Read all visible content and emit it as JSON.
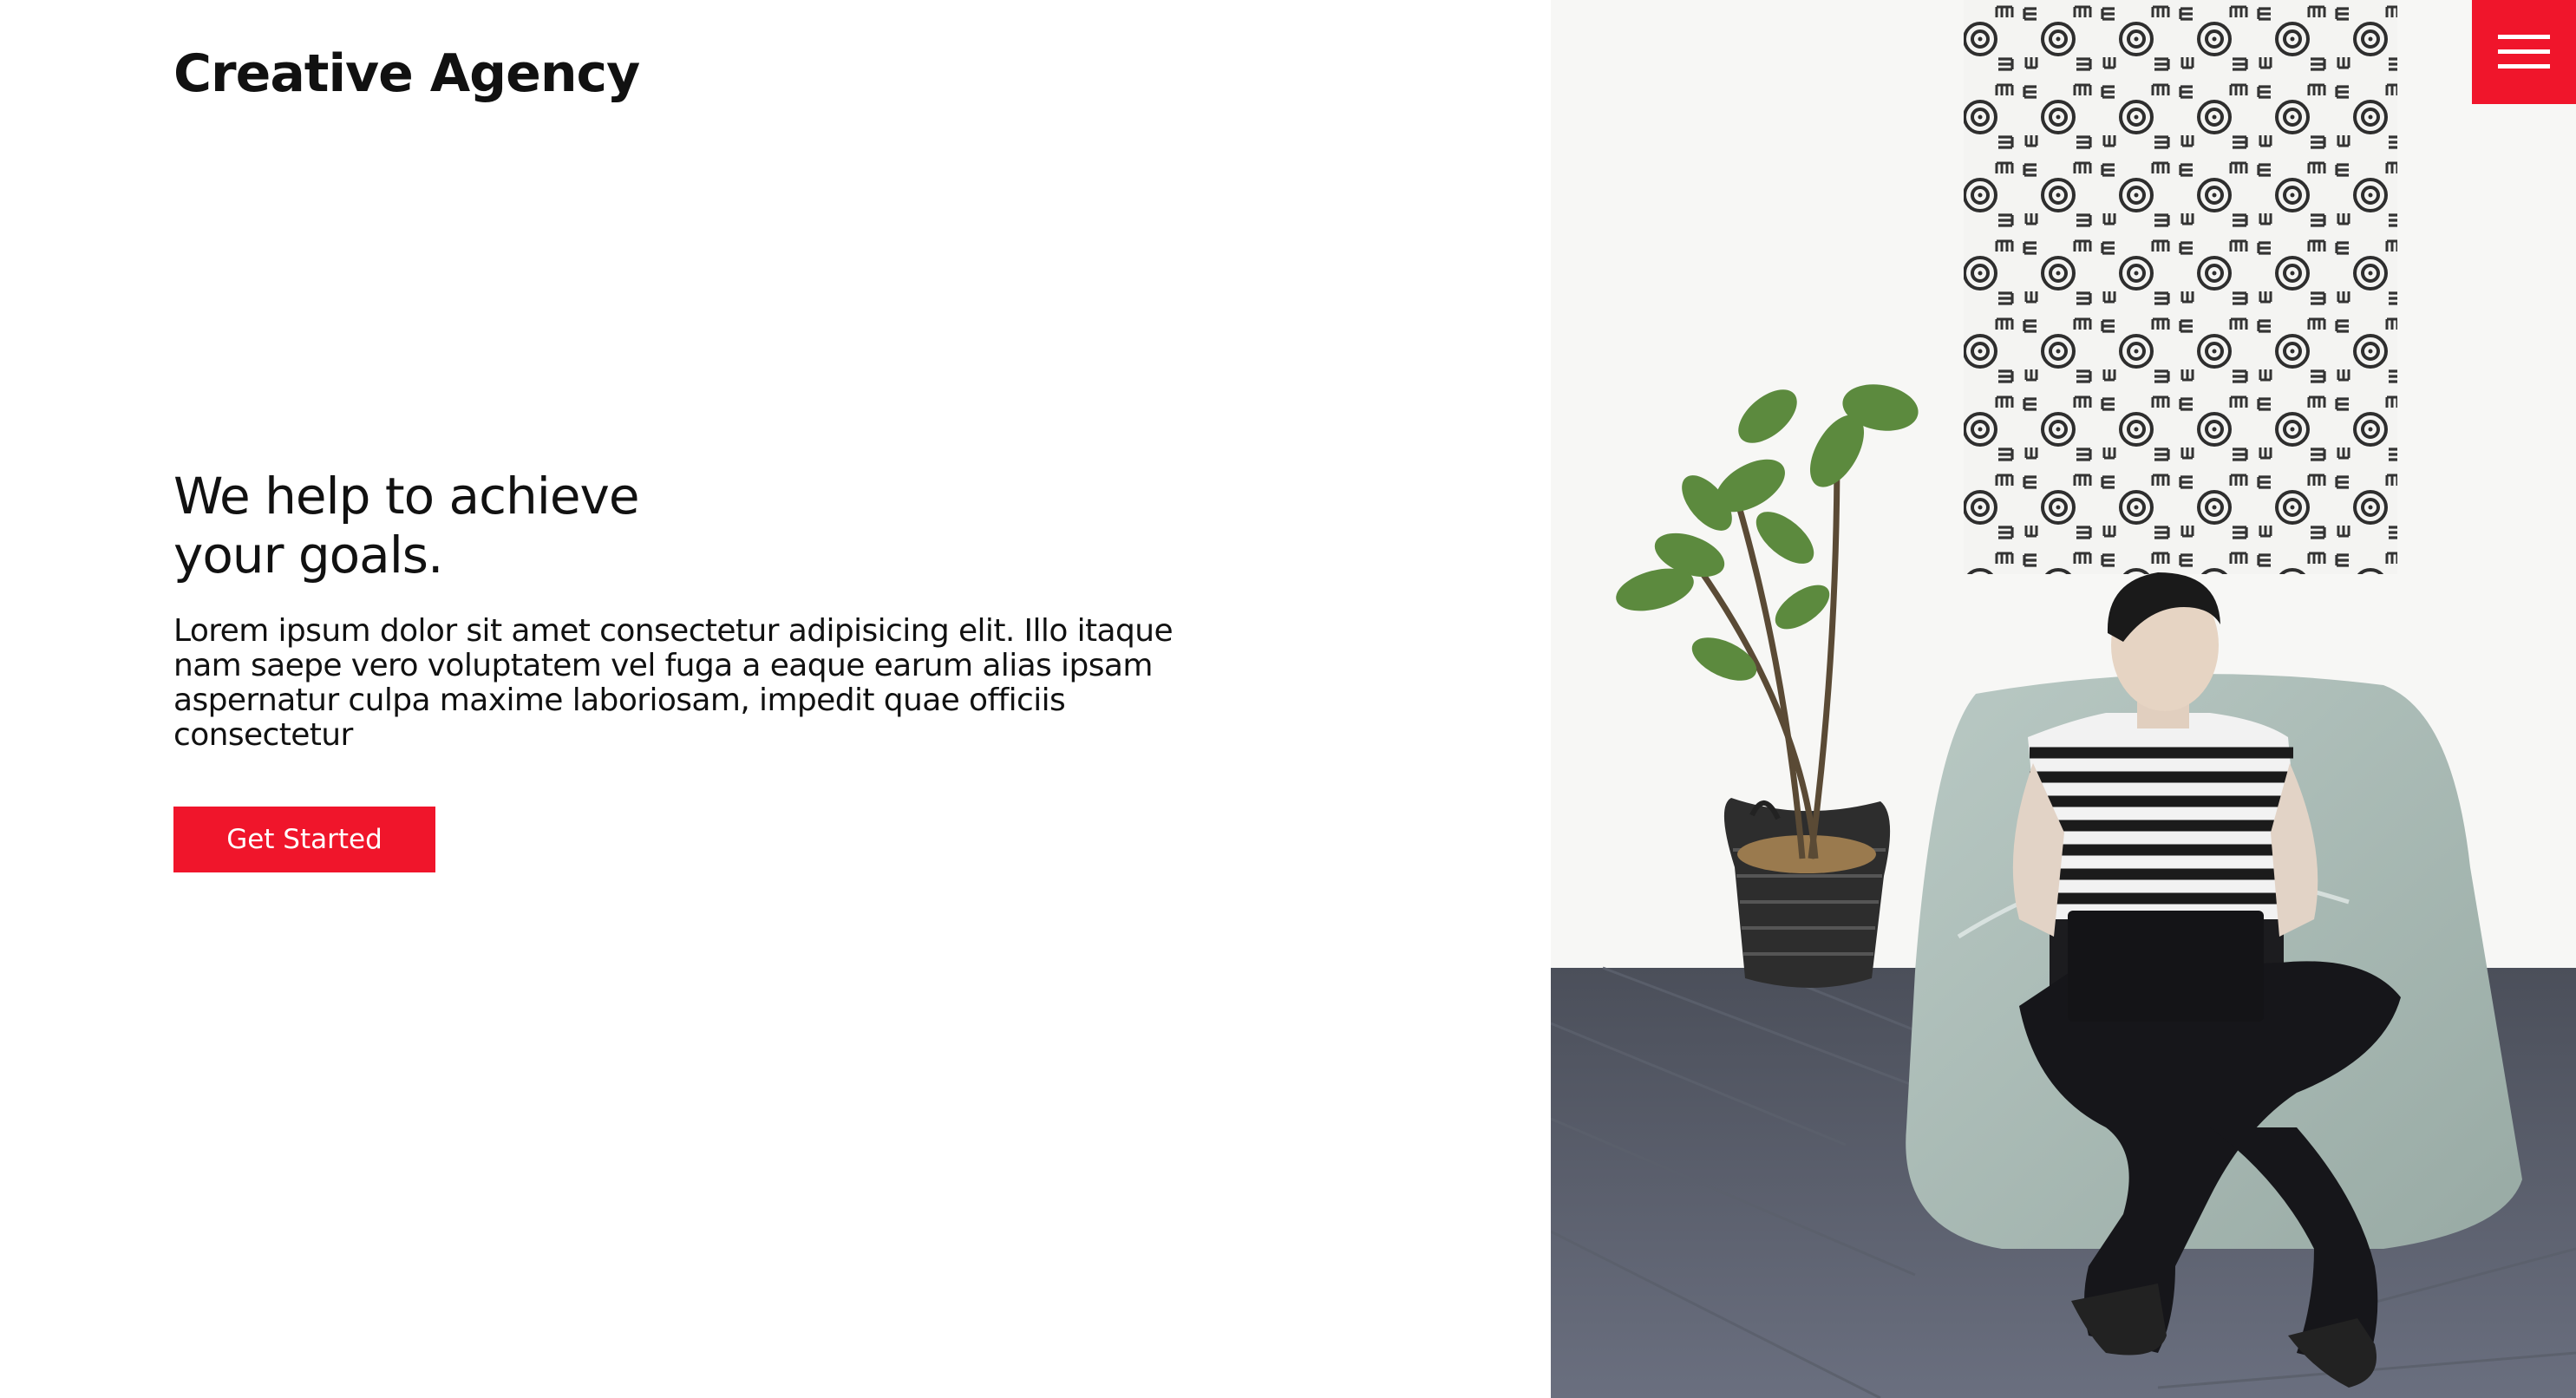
{
  "brand": {
    "name": "Creative Agency"
  },
  "hero": {
    "headline_line1": "We help to achieve",
    "headline_line2": "your goals.",
    "lead": "Lorem ipsum dolor sit amet consectetur adipisicing elit. Illo itaque nam saepe vero voluptatem vel fuga a eaque earum alias ipsam aspernatur culpa maxime laboriosam, impedit quae officiis consectetur",
    "cta_label": "Get Started"
  },
  "menu": {
    "icon": "hamburger-menu-icon"
  },
  "colors": {
    "accent": "#f0152b",
    "text": "#111111",
    "background": "#ffffff"
  }
}
